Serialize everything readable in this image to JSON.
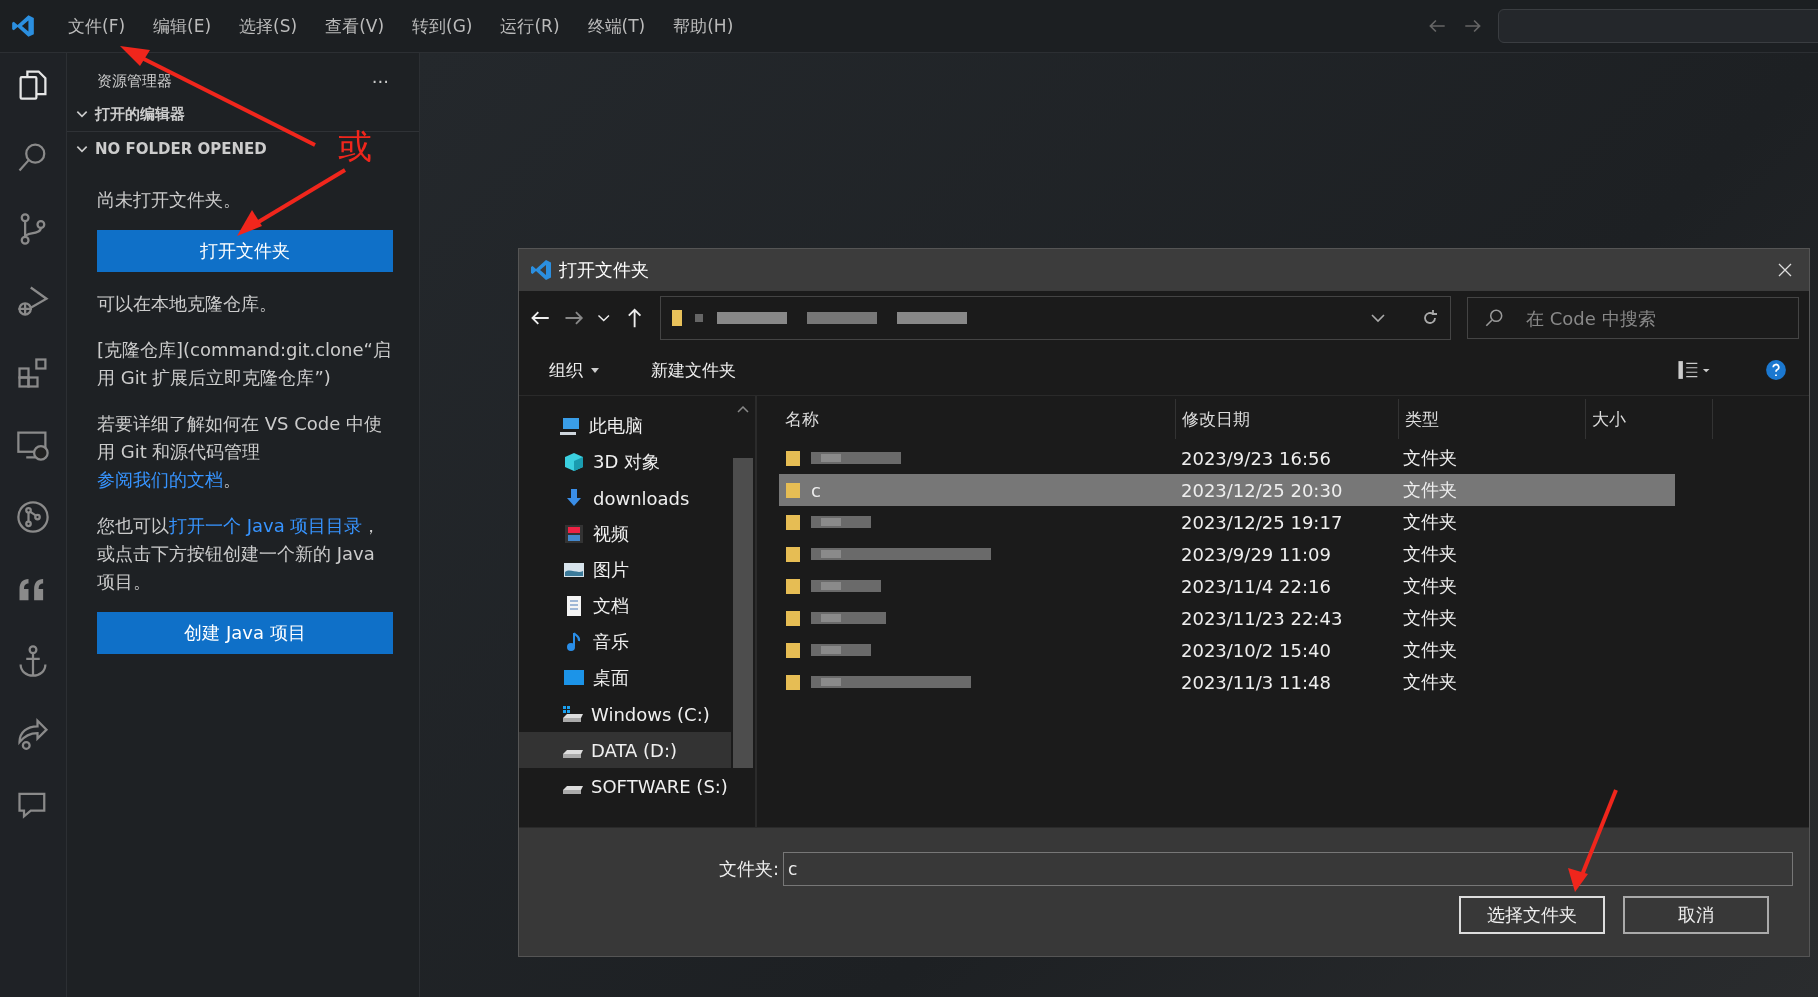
{
  "menu": [
    "文件(F)",
    "编辑(E)",
    "选择(S)",
    "查看(V)",
    "转到(G)",
    "运行(R)",
    "终端(T)",
    "帮助(H)"
  ],
  "activity_bar": [
    {
      "kind": "files",
      "selected": true
    },
    {
      "kind": "search",
      "selected": false
    },
    {
      "kind": "git",
      "selected": false
    },
    {
      "kind": "debug",
      "selected": false
    },
    {
      "kind": "extensions",
      "selected": false
    },
    {
      "kind": "remote",
      "selected": false
    },
    {
      "kind": "graph",
      "selected": false
    },
    {
      "kind": "quote",
      "selected": false
    },
    {
      "kind": "anchor",
      "selected": false
    },
    {
      "kind": "share",
      "selected": false
    },
    {
      "kind": "chat",
      "selected": false
    }
  ],
  "sidebar": {
    "title": "资源管理器",
    "more": "···",
    "sections": [
      {
        "label": "打开的编辑器",
        "expanded": true
      },
      {
        "label": "NO FOLDER OPENED",
        "expanded": true
      }
    ],
    "content": [
      {
        "kind": "text",
        "parts": [
          {
            "text": "尚未打开文件夹。"
          }
        ]
      },
      {
        "kind": "button",
        "label": "打开文件夹"
      },
      {
        "kind": "text",
        "parts": [
          {
            "text": "可以在本地克隆仓库。"
          }
        ]
      },
      {
        "kind": "text",
        "parts": [
          {
            "text": "[克隆仓库](command:git.clone“启用 Git 扩展后立即克隆仓库”)"
          }
        ]
      },
      {
        "kind": "text",
        "parts": [
          {
            "text": "若要详细了解如何在 VS Code 中使用 Git 和源代码管理"
          },
          {
            "text": "参阅我们的文档",
            "link": true
          },
          {
            "text": "。"
          }
        ]
      },
      {
        "kind": "text",
        "parts": [
          {
            "text": "您也可以"
          },
          {
            "text": "打开一个 Java 项目目录",
            "link": true
          },
          {
            "text": "，或点击下方按钮创建一个新的 Java 项目。"
          }
        ]
      },
      {
        "kind": "button",
        "label": "创建 Java 项目"
      }
    ]
  },
  "annotation": {
    "text": "或"
  },
  "dialog": {
    "title": "打开文件夹",
    "search": {
      "placeholder": "在 Code 中搜索"
    },
    "toolbar": [
      {
        "label": "组织",
        "dropdown": true
      },
      {
        "label": "新建文件夹",
        "dropdown": false
      }
    ],
    "nav": [
      {
        "label": "此电脑",
        "kind": "pc",
        "selected": false
      },
      {
        "label": "3D 对象",
        "kind": "cube",
        "selected": false
      },
      {
        "label": "downloads",
        "kind": "download",
        "selected": false
      },
      {
        "label": "视频",
        "kind": "video",
        "selected": false
      },
      {
        "label": "图片",
        "kind": "image",
        "selected": false
      },
      {
        "label": "文档",
        "kind": "doc",
        "selected": false
      },
      {
        "label": "音乐",
        "kind": "music",
        "selected": false
      },
      {
        "label": "桌面",
        "kind": "desktop",
        "selected": false
      },
      {
        "label": "Windows (C:)",
        "kind": "windrive",
        "selected": false
      },
      {
        "label": "DATA (D:)",
        "kind": "drive",
        "selected": true
      },
      {
        "label": "SOFTWARE (S:)",
        "kind": "drive",
        "selected": false
      }
    ],
    "columns": [
      "名称",
      "修改日期",
      "类型",
      "大小"
    ],
    "rows": [
      {
        "date": "2023/9/23 16:56",
        "type": "文件夹",
        "selected": false
      },
      {
        "name": "c",
        "date": "2023/12/25 20:30",
        "type": "文件夹",
        "selected": true
      },
      {
        "date": "2023/12/25 19:17",
        "type": "文件夹",
        "selected": false
      },
      {
        "date": "2023/9/29 11:09",
        "type": "文件夹",
        "selected": false
      },
      {
        "date": "2023/11/4 22:16",
        "type": "文件夹",
        "selected": false
      },
      {
        "date": "2023/11/23 22:43",
        "type": "文件夹",
        "selected": false
      },
      {
        "date": "2023/10/2 15:40",
        "type": "文件夹",
        "selected": false
      },
      {
        "date": "2023/11/3 11:48",
        "type": "文件夹",
        "selected": false
      }
    ],
    "folder_label": "文件夹:",
    "folder_value": "c",
    "buttons": [
      {
        "label": "选择文件夹",
        "primary": true
      },
      {
        "label": "取消",
        "primary": false
      }
    ]
  }
}
